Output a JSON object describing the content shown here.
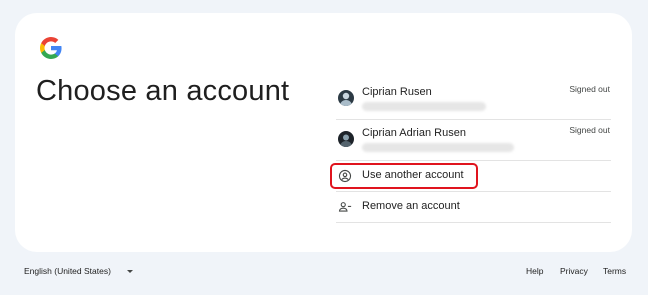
{
  "page": {
    "title": "Choose an account"
  },
  "accounts": [
    {
      "name": "Ciprian Rusen",
      "status": "Signed out"
    },
    {
      "name": "Ciprian Adrian Rusen",
      "status": "Signed out"
    }
  ],
  "actions": {
    "use_another": "Use another account",
    "remove": "Remove an account"
  },
  "footer": {
    "language": "English (United States)",
    "help": "Help",
    "privacy": "Privacy",
    "terms": "Terms"
  },
  "colors": {
    "background": "#f0f4f9",
    "card": "#ffffff",
    "highlight": "#e0141e",
    "google_blue": "#4285f4",
    "google_red": "#ea4335",
    "google_yellow": "#fbbc05",
    "google_green": "#34a853"
  },
  "icons": {
    "logo": "google-g-icon",
    "use_another": "account-circle-icon",
    "remove": "person-remove-icon",
    "language_dropdown": "caret-down-icon"
  }
}
